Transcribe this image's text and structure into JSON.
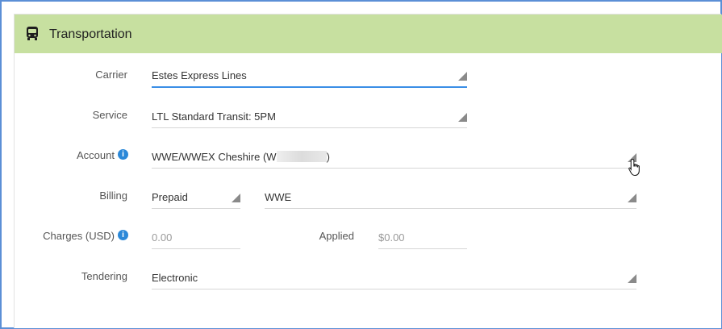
{
  "section": {
    "title": "Transportation",
    "icon": "bus-icon",
    "header_color": "#c7e0a0"
  },
  "fields": {
    "carrier": {
      "label": "Carrier",
      "value": "Estes Express Lines"
    },
    "service": {
      "label": "Service",
      "value": "LTL Standard Transit: 5PM"
    },
    "account": {
      "label": "Account",
      "value_prefix": "WWE/WWEX Cheshire (W",
      "value_suffix": ")"
    },
    "billing": {
      "label": "Billing",
      "type_value": "Prepaid",
      "party_value": "WWE"
    },
    "charges": {
      "label": "Charges (USD)",
      "value": "0.00",
      "applied_label": "Applied",
      "applied_value": "$0.00"
    },
    "tendering": {
      "label": "Tendering",
      "value": "Electronic"
    }
  },
  "colors": {
    "accent": "#3a8ee6",
    "info": "#2b88d8",
    "frame": "#5b8fd6"
  }
}
